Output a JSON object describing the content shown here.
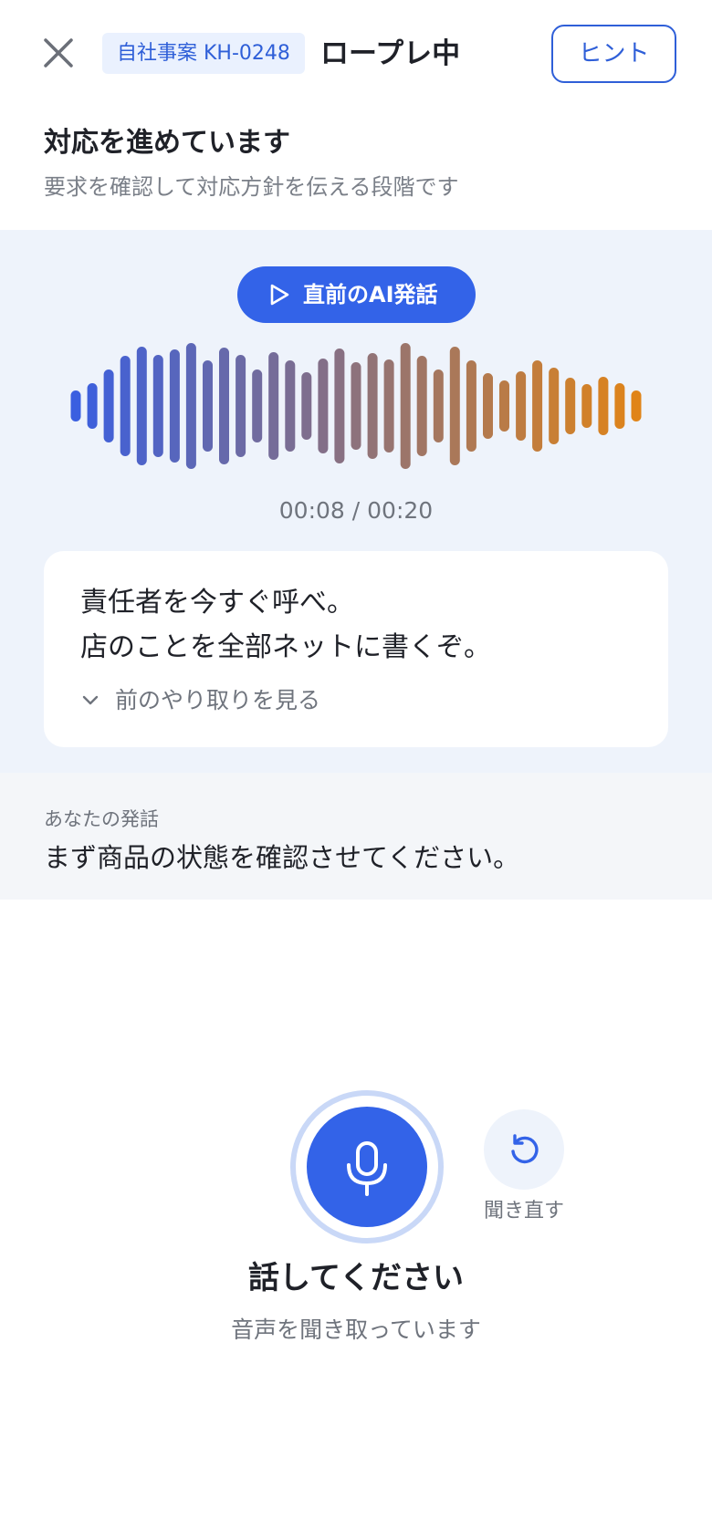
{
  "header": {
    "case_badge": "自社事案 KH-0248",
    "title": "ロープレ中",
    "hint_label": "ヒント",
    "close_icon": "close-icon"
  },
  "phase": {
    "title": "対応を進めています",
    "subtitle": "要求を確認して対応方針を伝える段階です"
  },
  "ai_panel": {
    "play_label": "直前のAI発話",
    "play_icon": "play-icon",
    "time_readout": "00:08 / 00:20",
    "playback_progress": 0.4,
    "waveform_colors": {
      "start": "#3a5fe0",
      "end": "#e08418"
    },
    "message_lines": [
      "責任者を今すぐ呼べ。",
      "店のことを全部ネットに書くぞ。"
    ],
    "prev_toggle_label": "前のやり取りを見る",
    "prev_toggle_icon": "chevron-down-icon"
  },
  "user_panel": {
    "label": "あなたの発話",
    "text": "まず商品の状態を確認させてください。"
  },
  "controls": {
    "mic_icon": "microphone-icon",
    "relisten_icon": "replay-icon",
    "relisten_label": "聞き直す",
    "prompt_title": "話してください",
    "prompt_sub": "音声を聞き取っています"
  },
  "colors": {
    "accent": "#3363e8",
    "badge_bg": "#eaf1fe",
    "panel_bg": "#eef3fb",
    "user_panel_bg": "#f4f6f9"
  }
}
